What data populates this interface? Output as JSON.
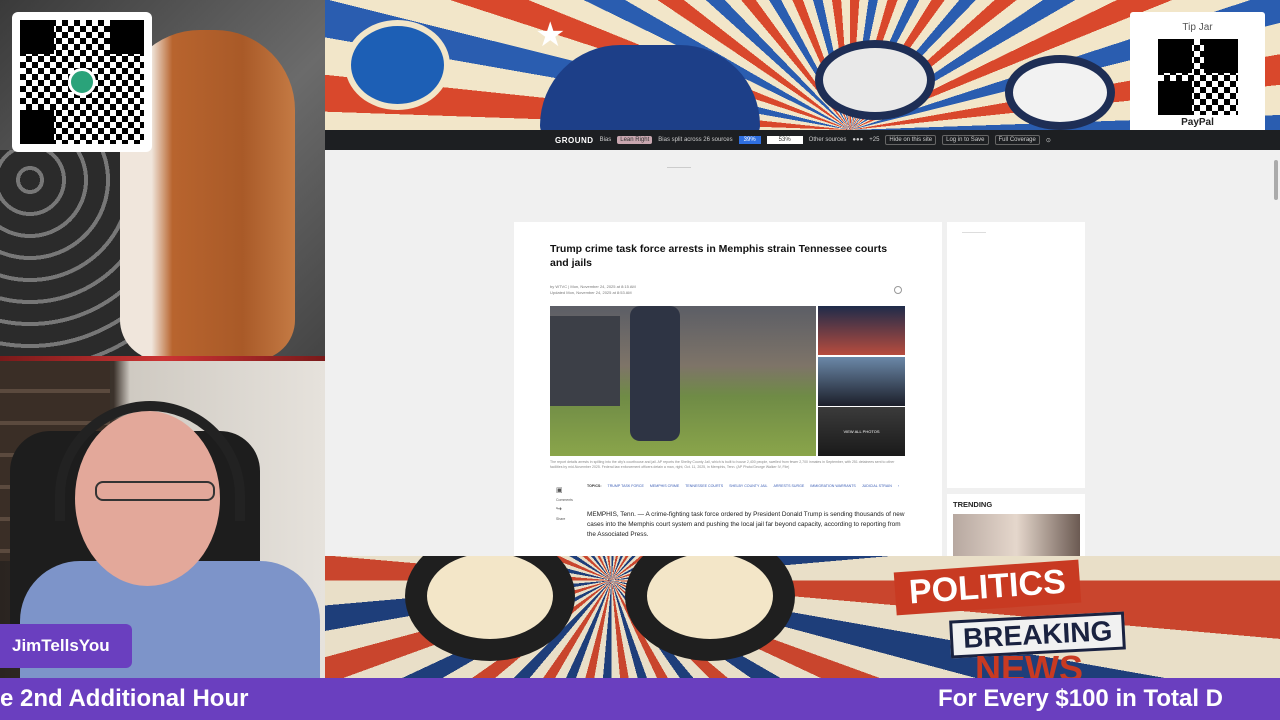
{
  "streamer": {
    "name": "JimTellsYou"
  },
  "tip_jar": {
    "title": "Tip Jar",
    "provider": "PayPal"
  },
  "ground_news": {
    "logo": "GROUND",
    "bias_label": "Bias",
    "lean": "Lean Right",
    "split_text": "Bias split across 26 sources",
    "left_pct": "39%",
    "center_pct": "53%",
    "other_sources": "Other sources",
    "more_count": "+25",
    "hide_btn": "Hide on this site",
    "login_btn": "Log in to Save",
    "coverage_btn": "Full Coverage"
  },
  "article": {
    "headline": "Trump crime task force arrests in Memphis strain Tennessee courts and jails",
    "byline": "by WTVC | Mon, November 24, 2025 at 8:15 AM",
    "updated": "Updated Mon, November 24, 2025 at 8:53 AM",
    "view_all": "VIEW ALL PHOTOS",
    "caption": "The report details arrests in spilling into the city's courthouse and jail. AP reports the Shelby County Jail, which is built to house 2,400 people, swelled from fewer 2,700 inmates in September, with 251 detainees sent to other facilities by mid-November 2025. Federal law enforcement officers detain a man, right, Oct. 11, 2025, in Memphis, Tenn. (AP Photo/George Walker IV, File)",
    "comments_label": "Comments",
    "share_label": "Share",
    "topics_label": "TOPICS:",
    "topics": [
      "TRUMP TASK FORCE",
      "MEMPHIS CRIME",
      "TENNESSEE COURTS",
      "SHELBY COUNTY JAIL",
      "ARRESTS SURGE",
      "IMMIGRATION WARRANTS",
      "JUDICIAL STRAIN"
    ],
    "body": "MEMPHIS, Tenn. — A crime-fighting task force ordered by President Donald Trump is sending thousands of new cases into the Memphis court system and pushing the local jail far beyond capacity, according to reporting from the Associated Press."
  },
  "sidebar": {
    "trending_label": "TRENDING"
  },
  "banner": {
    "politics": "POLITICS",
    "breaking": "BREAKING",
    "news": "NEWS"
  },
  "ticker": {
    "left_text": "e 2nd Additional Hour",
    "right_text": "For Every $100 in Total D"
  },
  "colors": {
    "ticker_bg": "#6a3fbf",
    "gn_left": "#2f6fe0",
    "banner_red": "#c83a22"
  }
}
